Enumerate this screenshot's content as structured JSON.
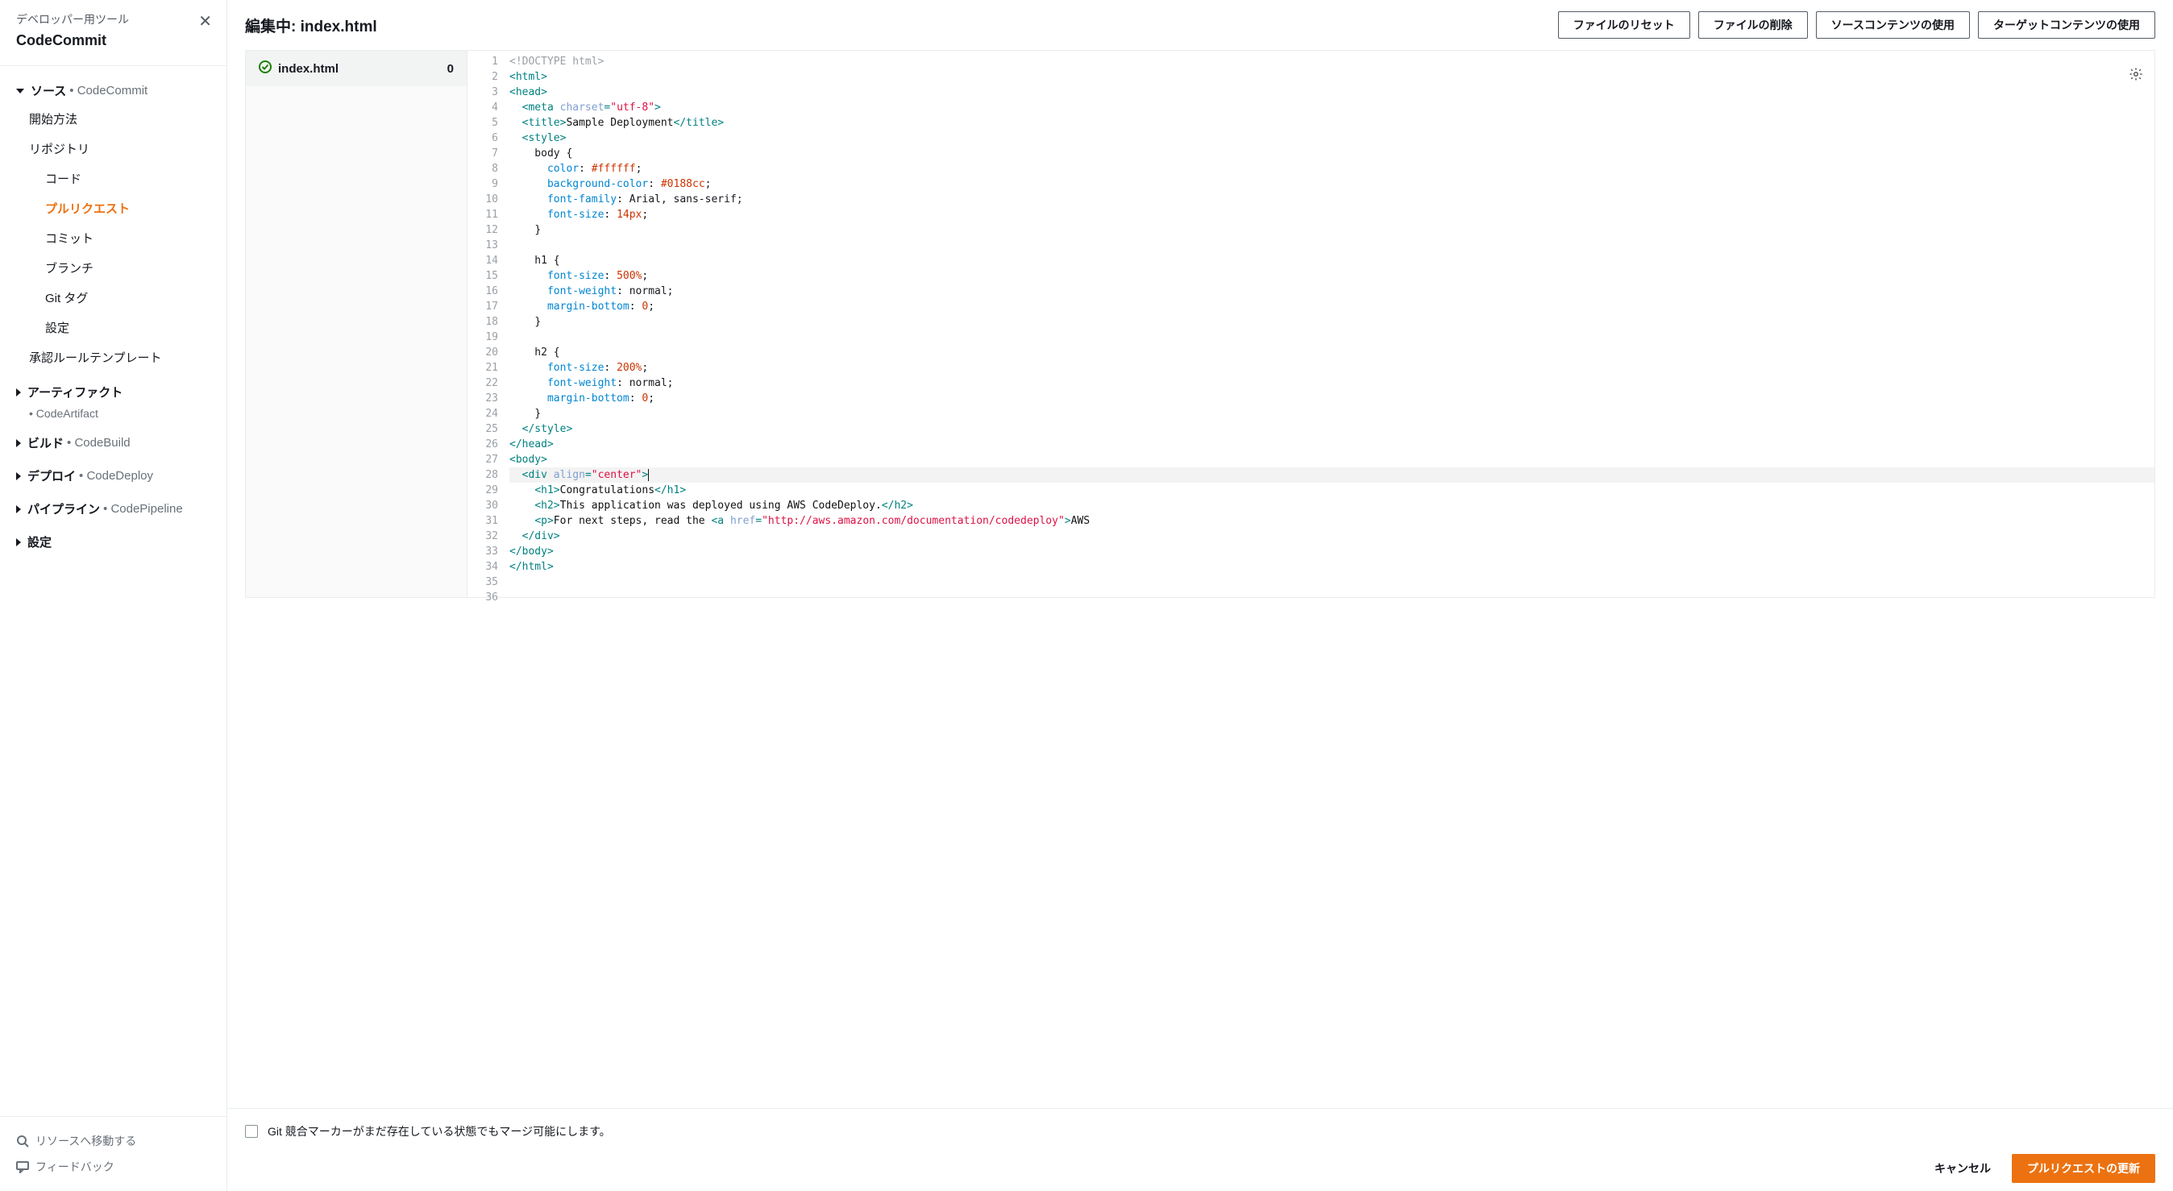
{
  "sidebar": {
    "tool_label": "デベロッパー用ツール",
    "service": "CodeCommit",
    "sections": [
      {
        "label": "ソース",
        "svc": "CodeCommit",
        "open": true
      },
      {
        "label": "アーティファクト",
        "svc": "",
        "open": false,
        "sub": "CodeArtifact"
      },
      {
        "label": "ビルド",
        "svc": "CodeBuild",
        "open": false
      },
      {
        "label": "デプロイ",
        "svc": "CodeDeploy",
        "open": false
      },
      {
        "label": "パイプライン",
        "svc": "CodePipeline",
        "open": false
      },
      {
        "label": "設定",
        "svc": "",
        "open": false
      }
    ],
    "items": {
      "getting_started": "開始方法",
      "repositories": "リポジトリ",
      "code": "コード",
      "pull_requests": "プルリクエスト",
      "commits": "コミット",
      "branches": "ブランチ",
      "git_tags": "Git タグ",
      "settings": "設定",
      "approval_templates": "承認ルールテンプレート"
    },
    "footer": {
      "goto": "リソースへ移動する",
      "feedback": "フィードバック"
    }
  },
  "toolbar": {
    "title_prefix": "編集中: ",
    "title_file": "index.html",
    "reset": "ファイルのリセット",
    "delete": "ファイルの削除",
    "use_source": "ソースコンテンツの使用",
    "use_target": "ターゲットコンテンツの使用"
  },
  "file_pane": {
    "filename": "index.html",
    "count": "0"
  },
  "code_lines": [
    [
      {
        "c": "tk-doctype",
        "t": "<!DOCTYPE html>"
      }
    ],
    [
      {
        "c": "tk-tag",
        "t": "<html>"
      }
    ],
    [
      {
        "c": "tk-tag",
        "t": "<head>"
      }
    ],
    [
      {
        "t": "  "
      },
      {
        "c": "tk-tag",
        "t": "<meta "
      },
      {
        "c": "tk-attr",
        "t": "charset"
      },
      {
        "c": "tk-tag",
        "t": "="
      },
      {
        "c": "tk-str",
        "t": "\"utf-8\""
      },
      {
        "c": "tk-tag",
        "t": ">"
      }
    ],
    [
      {
        "t": "  "
      },
      {
        "c": "tk-tag",
        "t": "<title>"
      },
      {
        "c": "tk-text",
        "t": "Sample Deployment"
      },
      {
        "c": "tk-tag",
        "t": "</title>"
      }
    ],
    [
      {
        "t": "  "
      },
      {
        "c": "tk-tag",
        "t": "<style>"
      }
    ],
    [
      {
        "t": "    body "
      },
      {
        "c": "tk-brace",
        "t": "{"
      }
    ],
    [
      {
        "t": "      "
      },
      {
        "c": "tk-prop",
        "t": "color"
      },
      {
        "t": ": "
      },
      {
        "c": "tk-num",
        "t": "#ffffff"
      },
      {
        "t": ";"
      }
    ],
    [
      {
        "t": "      "
      },
      {
        "c": "tk-prop",
        "t": "background-color"
      },
      {
        "t": ": "
      },
      {
        "c": "tk-num",
        "t": "#0188cc"
      },
      {
        "t": ";"
      }
    ],
    [
      {
        "t": "      "
      },
      {
        "c": "tk-prop",
        "t": "font-family"
      },
      {
        "t": ": Arial, sans-serif;"
      }
    ],
    [
      {
        "t": "      "
      },
      {
        "c": "tk-prop",
        "t": "font-size"
      },
      {
        "t": ": "
      },
      {
        "c": "tk-num",
        "t": "14px"
      },
      {
        "t": ";"
      }
    ],
    [
      {
        "t": "    "
      },
      {
        "c": "tk-brace",
        "t": "}"
      }
    ],
    [
      {
        "t": " "
      }
    ],
    [
      {
        "t": "    h1 "
      },
      {
        "c": "tk-brace",
        "t": "{"
      }
    ],
    [
      {
        "t": "      "
      },
      {
        "c": "tk-prop",
        "t": "font-size"
      },
      {
        "t": ": "
      },
      {
        "c": "tk-num",
        "t": "500%"
      },
      {
        "t": ";"
      }
    ],
    [
      {
        "t": "      "
      },
      {
        "c": "tk-prop",
        "t": "font-weight"
      },
      {
        "t": ": normal;"
      }
    ],
    [
      {
        "t": "      "
      },
      {
        "c": "tk-prop",
        "t": "margin-bottom"
      },
      {
        "t": ": "
      },
      {
        "c": "tk-num",
        "t": "0"
      },
      {
        "t": ";"
      }
    ],
    [
      {
        "t": "    "
      },
      {
        "c": "tk-brace",
        "t": "}"
      }
    ],
    [
      {
        "t": " "
      }
    ],
    [
      {
        "t": "    h2 "
      },
      {
        "c": "tk-brace",
        "t": "{"
      }
    ],
    [
      {
        "t": "      "
      },
      {
        "c": "tk-prop",
        "t": "font-size"
      },
      {
        "t": ": "
      },
      {
        "c": "tk-num",
        "t": "200%"
      },
      {
        "t": ";"
      }
    ],
    [
      {
        "t": "      "
      },
      {
        "c": "tk-prop",
        "t": "font-weight"
      },
      {
        "t": ": normal;"
      }
    ],
    [
      {
        "t": "      "
      },
      {
        "c": "tk-prop",
        "t": "margin-bottom"
      },
      {
        "t": ": "
      },
      {
        "c": "tk-num",
        "t": "0"
      },
      {
        "t": ";"
      }
    ],
    [
      {
        "t": "    "
      },
      {
        "c": "tk-brace",
        "t": "}"
      }
    ],
    [
      {
        "t": "  "
      },
      {
        "c": "tk-tag",
        "t": "</style>"
      }
    ],
    [
      {
        "c": "tk-tag",
        "t": "</head>"
      }
    ],
    [
      {
        "c": "tk-tag",
        "t": "<body>"
      }
    ],
    [
      {
        "t": "  "
      },
      {
        "c": "tk-tag",
        "t": "<div "
      },
      {
        "c": "tk-attr",
        "t": "align"
      },
      {
        "c": "tk-tag",
        "t": "="
      },
      {
        "c": "tk-str",
        "t": "\"center\""
      },
      {
        "c": "tk-tag",
        "t": ">"
      },
      {
        "c": "tk-cursor",
        "t": " "
      }
    ],
    [
      {
        "t": "    "
      },
      {
        "c": "tk-tag",
        "t": "<h1>"
      },
      {
        "c": "tk-text",
        "t": "Congratulations"
      },
      {
        "c": "tk-tag",
        "t": "</h1>"
      }
    ],
    [
      {
        "t": "    "
      },
      {
        "c": "tk-tag",
        "t": "<h2>"
      },
      {
        "c": "tk-text",
        "t": "This application was deployed using AWS CodeDeploy."
      },
      {
        "c": "tk-tag",
        "t": "</h2>"
      }
    ],
    [
      {
        "t": "    "
      },
      {
        "c": "tk-tag",
        "t": "<p>"
      },
      {
        "c": "tk-text",
        "t": "For next steps, read the "
      },
      {
        "c": "tk-tag",
        "t": "<a "
      },
      {
        "c": "tk-attr",
        "t": "href"
      },
      {
        "c": "tk-tag",
        "t": "="
      },
      {
        "c": "tk-str",
        "t": "\"http://aws.amazon.com/documentation/codedeploy\""
      },
      {
        "c": "tk-tag",
        "t": ">"
      },
      {
        "c": "tk-text",
        "t": "AWS"
      }
    ],
    [
      {
        "t": "  "
      },
      {
        "c": "tk-tag",
        "t": "</div>"
      }
    ],
    [
      {
        "c": "tk-tag",
        "t": "</body>"
      }
    ],
    [
      {
        "c": "tk-tag",
        "t": "</html>"
      }
    ],
    [
      {
        "t": " "
      }
    ],
    [
      {
        "t": " "
      }
    ]
  ],
  "highlight_line": 28,
  "footer": {
    "checkbox_label": "Git 競合マーカーがまだ存在している状態でもマージ可能にします。",
    "cancel": "キャンセル",
    "update": "プルリクエストの更新"
  }
}
